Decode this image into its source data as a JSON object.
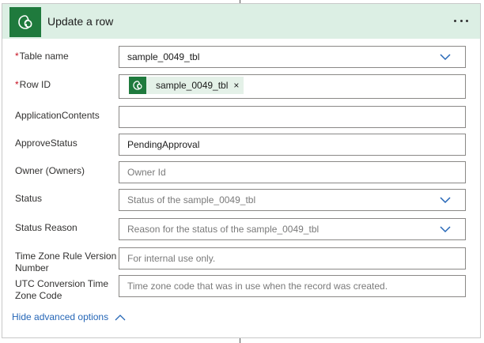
{
  "header": {
    "title": "Update a row",
    "more_icon": "ellipsis-icon",
    "connector_icon": "dataverse-logo-icon",
    "accent_color": "#1f7a3d",
    "header_bg": "#dcefe4"
  },
  "fields": {
    "table_name": {
      "required": "*",
      "label": "Table name",
      "value": "sample_0049_tbl"
    },
    "row_id": {
      "required": "*",
      "label": "Row ID",
      "token": "sample_0049_tbl",
      "token_close": "×"
    },
    "application_contents": {
      "label": "ApplicationContents",
      "value": ""
    },
    "approve_status": {
      "label": "ApproveStatus",
      "value": "PendingApproval"
    },
    "owner": {
      "label": "Owner (Owners)",
      "placeholder": "Owner Id"
    },
    "status": {
      "label": "Status",
      "placeholder": "Status of the sample_0049_tbl"
    },
    "status_reason": {
      "label": "Status Reason",
      "placeholder": "Reason for the status of the sample_0049_tbl"
    },
    "time_zone_rule": {
      "label_line1": "Time Zone Rule Version",
      "label_line2": "Number",
      "placeholder": "For internal use only."
    },
    "utc_conversion": {
      "label_line1": "UTC Conversion Time",
      "label_line2": "Zone Code",
      "placeholder": "Time zone code that was in use when the record was created."
    }
  },
  "footer": {
    "hide_advanced": "Hide advanced options",
    "link_color": "#2667b7"
  }
}
